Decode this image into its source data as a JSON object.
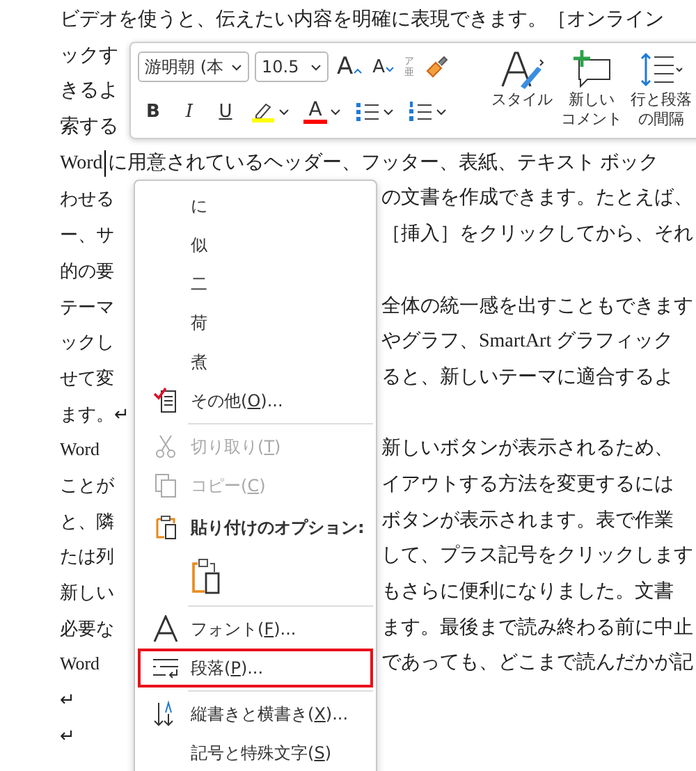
{
  "document": {
    "lines": [
      {
        "left": "ビデオを使うと、伝えたい内容を明確に表現できます。［オンライン"
      },
      {
        "left": "ックす"
      },
      {
        "left": "きるよ"
      },
      {
        "left": "索する"
      },
      {
        "left": "Word に用意されているヘッダー、フッター、表紙、テキスト ボック",
        "cursor": true
      },
      {
        "left": "わせる",
        "right": "の文書を作成できます。たとえば、"
      },
      {
        "left": "ー、サ",
        "right": "［挿入］をクリックしてから、それ"
      },
      {
        "left": "的の要"
      },
      {
        "left": "テーマ",
        "right": "全体の統一感を出すこともできます"
      },
      {
        "left": "ックし",
        "right": "やグラフ、SmartArt グラフィック"
      },
      {
        "left": "せて変",
        "right": "ると、新しいテーマに適合するよ"
      },
      {
        "left": "ます。↵"
      },
      {
        "left": "Word",
        "right": "新しいボタンが表示されるため、"
      },
      {
        "left": "ことが",
        "right": "イアウトする方法を変更するには"
      },
      {
        "left": "と、隣",
        "right": "ボタンが表示されます。表で作業"
      },
      {
        "left": "たは列",
        "right": "して、プラス記号をクリックします"
      },
      {
        "left": "新しい",
        "right": "もさらに便利になりました。文書"
      },
      {
        "left": "必要な",
        "right": "ます。最後まで読み終わる前に中止"
      },
      {
        "left": "Word",
        "right": "であっても、どこまで読んだかが記"
      },
      {
        "left": "↵"
      },
      {
        "left": "↵"
      }
    ]
  },
  "mini_toolbar": {
    "font_name": "游明朝 (本",
    "font_size": "10.5",
    "grow_font": "A",
    "shrink_font": "A",
    "phonetic": [
      "ア",
      "亜"
    ],
    "bold": "B",
    "italic": "I",
    "underline": "U",
    "font_color_glyph": "A",
    "styles_label": "スタイル",
    "comment_label": [
      "新しい",
      "コメント"
    ],
    "spacing_label": [
      "行と段落",
      "の間隔"
    ]
  },
  "menu": {
    "items": [
      {
        "kind": "candidate",
        "label": "に",
        "selected": false
      },
      {
        "kind": "candidate",
        "label": "似",
        "selected": false
      },
      {
        "kind": "candidate",
        "label": "二",
        "selected": false
      },
      {
        "kind": "candidate",
        "label": "荷",
        "selected": false
      },
      {
        "kind": "candidate",
        "label": "煮",
        "selected": false
      },
      {
        "kind": "command",
        "before": "その他(",
        "key": "O",
        "after": ")...",
        "disabled": false,
        "selected": false
      },
      {
        "kind": "separator"
      },
      {
        "kind": "command",
        "before": "切り取り(",
        "key": "T",
        "after": ")",
        "disabled": true,
        "selected": false
      },
      {
        "kind": "command",
        "before": "コピー(",
        "key": "C",
        "after": ")",
        "disabled": true,
        "selected": false
      },
      {
        "kind": "heading",
        "label": "貼り付けのオプション:"
      },
      {
        "kind": "paste"
      },
      {
        "kind": "separator"
      },
      {
        "kind": "command",
        "before": "フォント(",
        "key": "F",
        "after": ")...",
        "disabled": false,
        "selected": false
      },
      {
        "kind": "command",
        "before": "段落(",
        "key": "P",
        "after": ")...",
        "disabled": false,
        "selected": true
      },
      {
        "kind": "separator"
      },
      {
        "kind": "command",
        "before": "縦書きと横書き(",
        "key": "X",
        "after": ")...",
        "disabled": false,
        "selected": false
      },
      {
        "kind": "command",
        "before": "記号と特殊文字(",
        "key": "S",
        "after": ")",
        "disabled": false,
        "selected": false
      }
    ]
  }
}
